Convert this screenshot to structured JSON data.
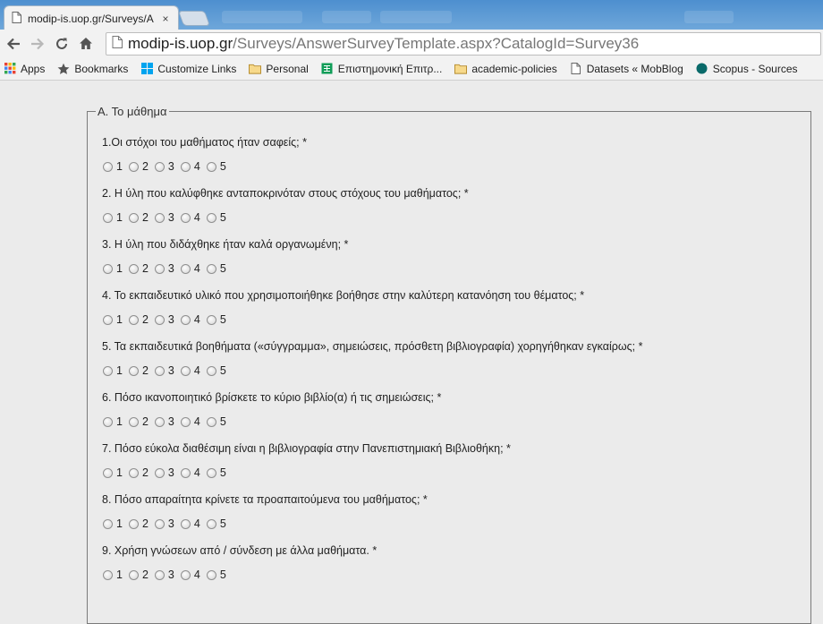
{
  "browser": {
    "tab_title": "modip-is.uop.gr/Surveys/A",
    "tab_close": "×",
    "url_host": "modip-is.uop.gr",
    "url_path": "/Surveys/AnswerSurveyTemplate.aspx?CatalogId=Survey36"
  },
  "bookmarks": [
    {
      "label": "Apps",
      "icon": "apps-grid-icon"
    },
    {
      "label": "Bookmarks",
      "icon": "star-icon"
    },
    {
      "label": "Customize Links",
      "icon": "windows-logo-icon"
    },
    {
      "label": "Personal",
      "icon": "folder-icon"
    },
    {
      "label": "Επιστημονική Επιτρ...",
      "icon": "sheet-icon"
    },
    {
      "label": "academic-policies",
      "icon": "folder-icon"
    },
    {
      "label": "Datasets « MobBlog",
      "icon": "page-icon"
    },
    {
      "label": "Scopus - Sources",
      "icon": "circle-icon"
    }
  ],
  "section": {
    "legend": "Α. Το μάθημα",
    "questions": [
      {
        "text": "1.Οι στόχοι του μαθήματος ήταν σαφείς; *"
      },
      {
        "text": "2. Η ύλη που καλύφθηκε ανταποκρινόταν στους στόχους του μαθήματος; *"
      },
      {
        "text": "3. Η ύλη που διδάχθηκε ήταν καλά οργανωμένη; *"
      },
      {
        "text": "4. Το εκπαιδευτικό υλικό που χρησιμοποιήθηκε βοήθησε στην καλύτερη κατανόηση του θέματος; *"
      },
      {
        "text": "5. Τα εκπαιδευτικά βοηθήματα («σύγγραμμα», σημειώσεις, πρόσθετη βιβλιογραφία) χορηγήθηκαν εγκαίρως; *"
      },
      {
        "text": "6. Πόσο ικανοποιητικό βρίσκετε το κύριο βιβλίο(α) ή τις σημειώσεις; *"
      },
      {
        "text": "7. Πόσο εύκολα διαθέσιμη είναι η βιβλιογραφία στην Πανεπιστημιακή Βιβλιοθήκη; *"
      },
      {
        "text": "8. Πόσο απαραίτητα κρίνετε τα προαπαιτούμενα του μαθήματος; *"
      },
      {
        "text": "9. Χρήση γνώσεων από / σύνδεση με άλλα μαθήματα. *"
      }
    ],
    "options": [
      "1",
      "2",
      "3",
      "4",
      "5"
    ]
  }
}
